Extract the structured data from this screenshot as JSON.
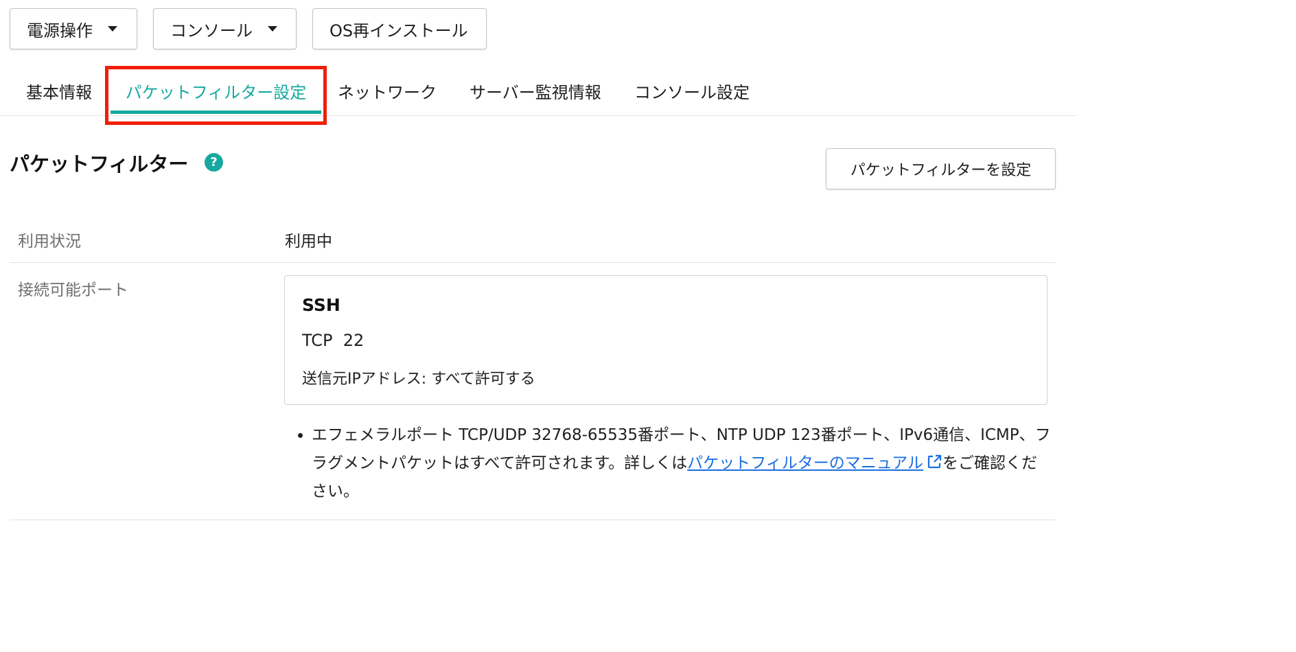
{
  "toolbar": {
    "power_label": "電源操作",
    "console_label": "コンソール",
    "os_reinstall_label": "OS再インストール"
  },
  "tabs": [
    {
      "label": "基本情報",
      "active": false
    },
    {
      "label": "パケットフィルター設定",
      "active": true
    },
    {
      "label": "ネットワーク",
      "active": false
    },
    {
      "label": "サーバー監視情報",
      "active": false
    },
    {
      "label": "コンソール設定",
      "active": false
    }
  ],
  "section": {
    "title": "パケットフィルター",
    "help_glyph": "?",
    "set_button_label": "パケットフィルターを設定"
  },
  "usage": {
    "label": "利用状況",
    "value": "利用中"
  },
  "ports": {
    "label": "接続可能ポート",
    "entries": [
      {
        "name": "SSH",
        "protocol": "TCP",
        "port": "22",
        "source": "送信元IPアドレス: すべて許可する"
      }
    ]
  },
  "note": {
    "text_before": "エフェメラルポート TCP/UDP 32768-65535番ポート、NTP UDP 123番ポート、IPv6通信、ICMP、フラグメントパケットはすべて許可されます。詳しくは",
    "link_text": "パケットフィルターのマニュアル",
    "text_after": "をご確認ください。"
  },
  "colors": {
    "accent": "#15a99f",
    "highlight": "#f01e0a",
    "link": "#1a6ee0"
  },
  "icons": {
    "dropdown": "caret-down-icon",
    "help": "help-icon",
    "external_link": "external-link-icon"
  }
}
